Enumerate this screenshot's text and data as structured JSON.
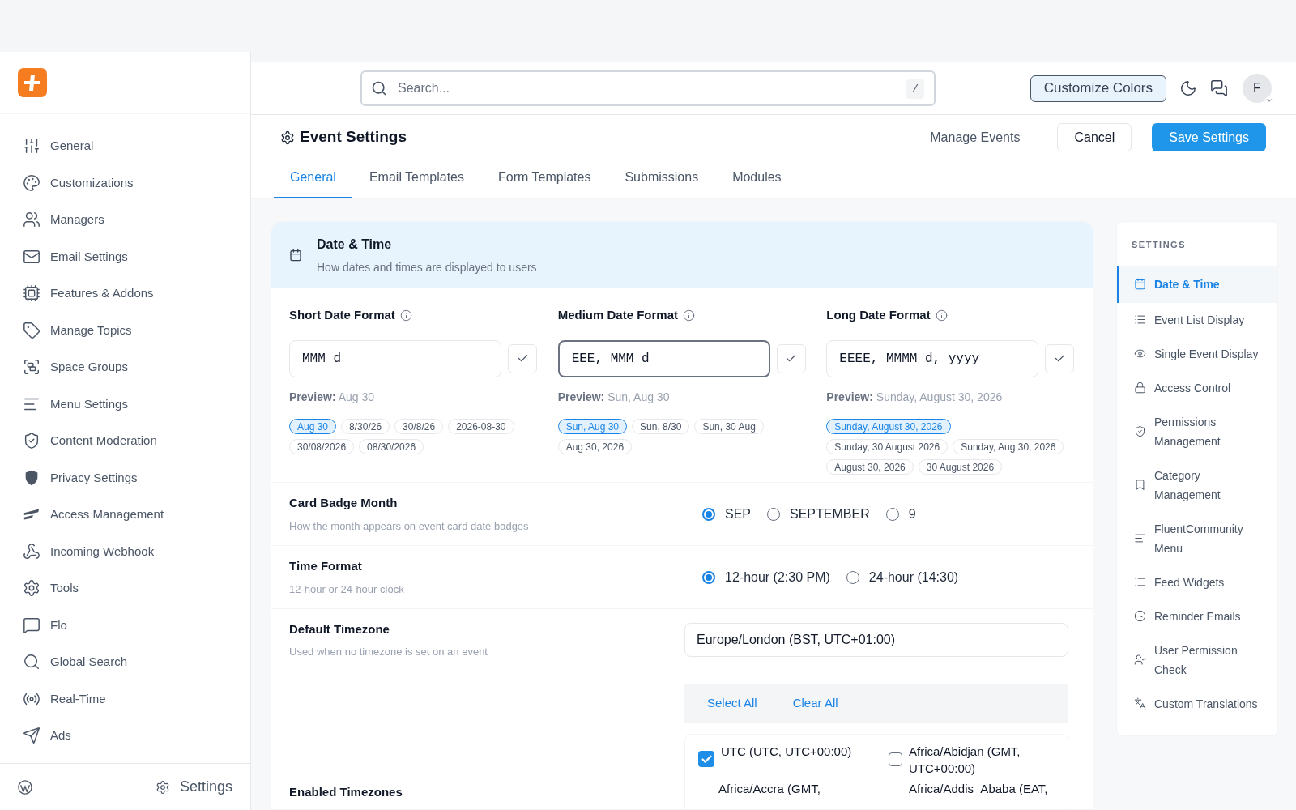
{
  "sidebar": {
    "items": [
      {
        "label": "General",
        "selected": false
      },
      {
        "label": "Customizations",
        "selected": false
      },
      {
        "label": "Managers",
        "selected": false
      },
      {
        "label": "Email Settings",
        "selected": false
      },
      {
        "label": "Features & Addons",
        "selected": false
      },
      {
        "label": "Manage Topics",
        "selected": false
      },
      {
        "label": "Space Groups",
        "selected": false
      },
      {
        "label": "Menu Settings",
        "selected": false
      },
      {
        "label": "Content Moderation",
        "selected": false
      },
      {
        "label": "Privacy Settings",
        "selected": false
      },
      {
        "label": "Access Management",
        "selected": false
      },
      {
        "label": "Incoming Webhook",
        "selected": false
      },
      {
        "label": "Tools",
        "selected": false
      },
      {
        "label": "Flo",
        "selected": false
      },
      {
        "label": "Global Search",
        "selected": false
      },
      {
        "label": "Real-Time",
        "selected": false
      },
      {
        "label": "Ads",
        "selected": false
      }
    ],
    "footer_link": "Settings"
  },
  "header": {
    "search_placeholder": "Search...",
    "shortcut": "/",
    "customize": "Customize Colors",
    "avatar": "F"
  },
  "page": {
    "title": "Event Settings",
    "manage_link": "Manage Events",
    "cancel": "Cancel",
    "save": "Save Settings"
  },
  "tabs": [
    {
      "label": "General",
      "selected": true
    },
    {
      "label": "Email Templates",
      "selected": false
    },
    {
      "label": "Form Templates",
      "selected": false
    },
    {
      "label": "Submissions",
      "selected": false
    },
    {
      "label": "Modules",
      "selected": false
    }
  ],
  "section": {
    "title": "Date & Time",
    "subtitle": "How dates and times are displayed to users"
  },
  "date_formats": [
    {
      "label": "Short Date Format",
      "value": "MMM d",
      "focused": false,
      "preview_label": "Preview:",
      "preview": "Aug 30",
      "chips": [
        {
          "label": "Aug 30",
          "selected": true
        },
        {
          "label": "8/30/26",
          "selected": false
        },
        {
          "label": "30/8/26",
          "selected": false
        },
        {
          "label": "2026-08-30",
          "selected": false
        },
        {
          "label": "30/08/2026",
          "selected": false
        },
        {
          "label": "08/30/2026",
          "selected": false
        }
      ]
    },
    {
      "label": "Medium Date Format",
      "value": "EEE, MMM d",
      "focused": true,
      "preview_label": "Preview:",
      "preview": "Sun, Aug 30",
      "chips": [
        {
          "label": "Sun, Aug 30",
          "selected": true
        },
        {
          "label": "Sun, 8/30",
          "selected": false
        },
        {
          "label": "Sun, 30 Aug",
          "selected": false
        },
        {
          "label": "Aug 30, 2026",
          "selected": false
        }
      ]
    },
    {
      "label": "Long Date Format",
      "value": "EEEE, MMMM d, yyyy",
      "focused": false,
      "preview_label": "Preview:",
      "preview": "Sunday, August 30, 2026",
      "chips": [
        {
          "label": "Sunday, August 30, 2026",
          "selected": true
        },
        {
          "label": "Sunday, 30 August 2026",
          "selected": false
        },
        {
          "label": "Sunday, Aug 30, 2026",
          "selected": false
        },
        {
          "label": "August 30, 2026",
          "selected": false
        },
        {
          "label": "30 August 2026",
          "selected": false
        }
      ]
    }
  ],
  "card_badge": {
    "label": "Card Badge Month",
    "description": "How the month appears on event card date badges",
    "options": [
      {
        "label": "SEP",
        "selected": true
      },
      {
        "label": "SEPTEMBER",
        "selected": false
      },
      {
        "label": "9",
        "selected": false
      }
    ]
  },
  "time_format": {
    "label": "Time Format",
    "description": "12-hour or 24-hour clock",
    "options": [
      {
        "label": "12-hour (2:30 PM)",
        "selected": true
      },
      {
        "label": "24-hour (14:30)",
        "selected": false
      }
    ]
  },
  "default_timezone": {
    "label": "Default Timezone",
    "description": "Used when no timezone is set on an event",
    "value": "Europe/London (BST, UTC+01:00)"
  },
  "enabled_timezones": {
    "label": "Enabled Timezones",
    "select_all": "Select All",
    "clear_all": "Clear All",
    "items": [
      {
        "label": "UTC (UTC, UTC+00:00)",
        "checked": true
      },
      {
        "label": "Africa/Abidjan (GMT, UTC+00:00)",
        "checked": false
      },
      {
        "label": "Africa/Accra (GMT,"
      },
      {
        "label": "Africa/Addis_Ababa (EAT,"
      }
    ]
  },
  "settings_nav": {
    "title": "SETTINGS",
    "items": [
      {
        "label": "Date & Time",
        "selected": true
      },
      {
        "label": "Event List Display",
        "selected": false
      },
      {
        "label": "Single Event Display",
        "selected": false
      },
      {
        "label": "Access Control",
        "selected": false
      },
      {
        "label": "Permissions Management",
        "selected": false
      },
      {
        "label": "Category Management",
        "selected": false
      },
      {
        "label": "FluentCommunity Menu",
        "selected": false
      },
      {
        "label": "Feed Widgets",
        "selected": false
      },
      {
        "label": "Reminder Emails",
        "selected": false
      },
      {
        "label": "User Permission Check",
        "selected": false
      },
      {
        "label": "Custom Translations",
        "selected": false
      }
    ]
  }
}
